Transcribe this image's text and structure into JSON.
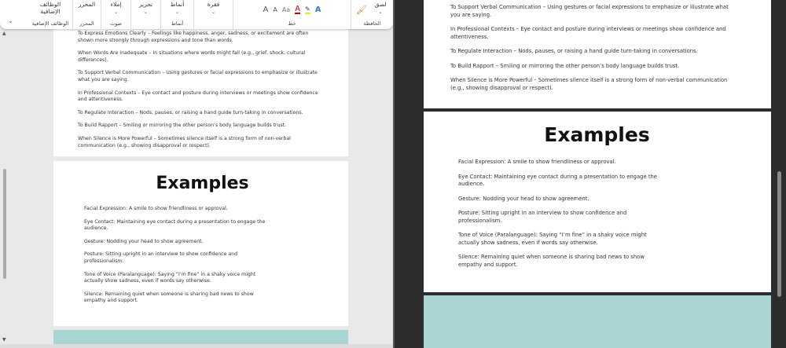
{
  "ribbon": {
    "groups": [
      {
        "name": "الحافظة",
        "button": "لصق"
      },
      {
        "name": "خط",
        "button": ""
      },
      {
        "name": "فقرة",
        "button": "فقرة"
      },
      {
        "name": "أنماط",
        "button": "أنماط"
      },
      {
        "name": "",
        "button": "تحرير"
      },
      {
        "name": "صوت",
        "button": "إملاء"
      },
      {
        "name": "المحرر",
        "button": "المحرر"
      },
      {
        "name": "الوظائف الإضافية",
        "button": "الوظائف الإضافية"
      }
    ],
    "font_buttons": {
      "grow": "A",
      "shrink": "A",
      "case": "Aa",
      "color": "A",
      "effects": "A"
    }
  },
  "left_doc": {
    "intro_cut": "To Express Emotions Clearly – Feelings like happiness, anger, sadness, or excitement are often shown more strongly through expressions and tone than words.",
    "paragraphs": [
      "When Words Are Inadequate – In situations where words might fail (e.g., grief, shock, cultural differences).",
      "To Support Verbal Communication – Using gestures or facial expressions to emphasize or illustrate what you are saying.",
      "In Professional Contexts – Eye contact and posture during interviews or meetings show confidence and attentiveness.",
      "To Regulate Interaction – Nods, pauses, or raising a hand guide turn-taking in conversations.",
      "To Build Rapport – Smiling or mirroring the other person’s body language builds trust.",
      "When Silence is More Powerful – Sometimes silence itself is a strong form of non-verbal communication (e.g., showing disapproval or respect)."
    ],
    "examples_title": "Examples",
    "examples": [
      "Facial Expression: A smile to show friendliness or approval.",
      "Eye Contact: Maintaining eye contact during a presentation to engage the audience.",
      "Gesture: Nodding your head to show agreement.",
      "Posture: Sitting upright in an interview to show confidence and professionalism.",
      "Tone of Voice (Paralanguage): Saying “I’m fine” in a shaky voice might actually show sadness, even if words say otherwise.",
      "Silence: Remaining quiet when someone is sharing bad news to show empathy and support."
    ]
  },
  "right_doc": {
    "paragraphs": [
      "To Support Verbal Communication – Using gestures or facial expressions to emphasize or illustrate what you are saying.",
      "In Professional Contexts – Eye contact and posture during interviews or meetings show confidence and attentiveness.",
      "To Regulate Interaction – Nods, pauses, or raising a hand guide turn-taking in conversations.",
      "To Build Rapport – Smiling or mirroring the other person’s body language builds trust.",
      "When Silence is More Powerful – Sometimes silence itself is a strong form of non-verbal communication (e.g., showing disapproval or respect)."
    ],
    "examples_title": "Examples",
    "examples": [
      "Facial Expression: A smile to show friendliness or approval.",
      "Eye Contact: Maintaining eye contact during a presentation to engage the audience.",
      "Gesture: Nodding your head to show agreement.",
      "Posture: Sitting upright in an interview to show confidence and professionalism.",
      "Tone of Voice (Paralanguage): Saying “I’m fine” in a shaky voice might actually show sadness, even if words say otherwise.",
      "Silence: Remaining quiet when someone is sharing bad news to show empathy and support."
    ]
  }
}
